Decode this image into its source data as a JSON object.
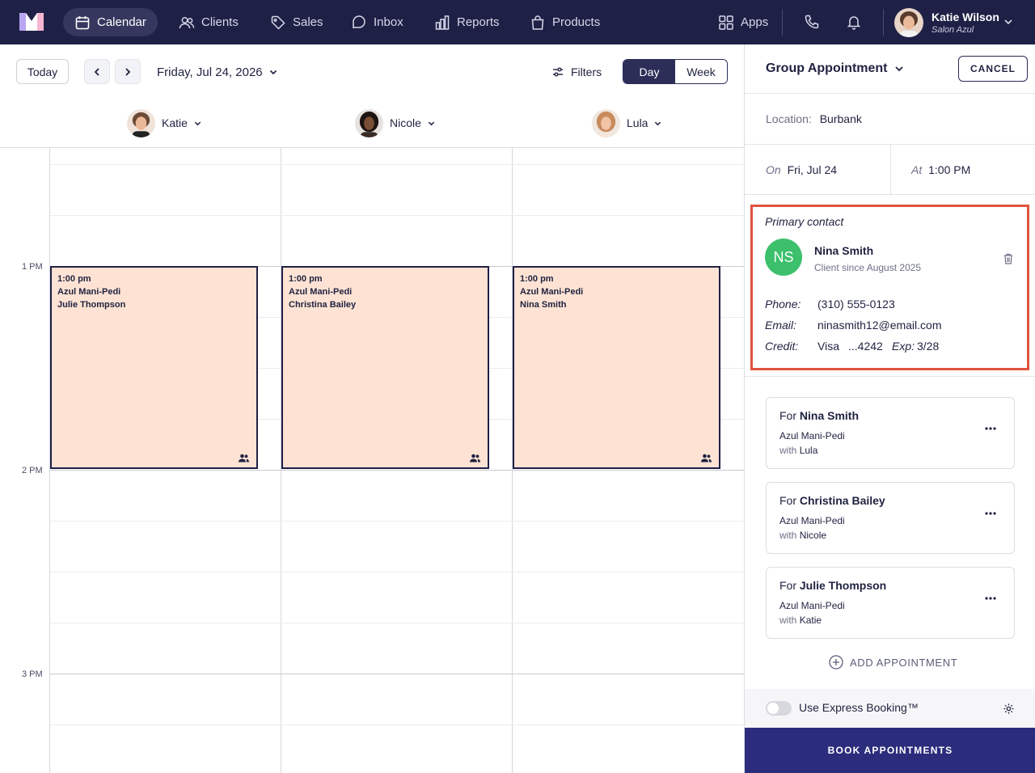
{
  "nav": {
    "items": [
      {
        "label": "Calendar",
        "icon": "calendar-icon",
        "active": true
      },
      {
        "label": "Clients",
        "icon": "users-icon"
      },
      {
        "label": "Sales",
        "icon": "tag-icon"
      },
      {
        "label": "Inbox",
        "icon": "chat-icon"
      },
      {
        "label": "Reports",
        "icon": "bar-chart-icon"
      },
      {
        "label": "Products",
        "icon": "bag-icon"
      }
    ],
    "apps_label": "Apps",
    "user": {
      "name": "Katie Wilson",
      "salon": "Salon Azul"
    }
  },
  "toolbar": {
    "today_label": "Today",
    "date_label": "Friday, Jul 24, 2026",
    "filters_label": "Filters",
    "view_day": "Day",
    "view_week": "Week",
    "active_view": "Day"
  },
  "staff": [
    {
      "name": "Katie"
    },
    {
      "name": "Nicole"
    },
    {
      "name": "Lula"
    }
  ],
  "time_labels": [
    "1 PM",
    "2 PM",
    "3 PM"
  ],
  "appointments": [
    {
      "time": "1:00 pm",
      "service": "Azul Mani-Pedi",
      "client": "Julie Thompson"
    },
    {
      "time": "1:00 pm",
      "service": "Azul Mani-Pedi",
      "client": "Christina Bailey"
    },
    {
      "time": "1:00 pm",
      "service": "Azul Mani-Pedi",
      "client": "Nina Smith"
    }
  ],
  "panel": {
    "title": "Group Appointment",
    "cancel_label": "CANCEL",
    "location_label": "Location:",
    "location_value": "Burbank",
    "on_label": "On",
    "on_value": "Fri, Jul 24",
    "at_label": "At",
    "at_value": "1:00 PM",
    "primary_contact": {
      "heading": "Primary contact",
      "initials": "NS",
      "name": "Nina Smith",
      "since": "Client since August 2025",
      "phone_label": "Phone:",
      "phone": "(310) 555-0123",
      "email_label": "Email:",
      "email": "ninasmith12@email.com",
      "credit_label": "Credit:",
      "card_brand": "Visa",
      "card_last4": "...4242",
      "exp_label": "Exp:",
      "exp_value": "3/28"
    },
    "group_items": [
      {
        "for_prefix": "For",
        "client": "Nina Smith",
        "service": "Azul Mani-Pedi",
        "with_prefix": "with",
        "staff": "Lula"
      },
      {
        "for_prefix": "For",
        "client": "Christina Bailey",
        "service": "Azul Mani-Pedi",
        "with_prefix": "with",
        "staff": "Nicole"
      },
      {
        "for_prefix": "For",
        "client": "Julie Thompson",
        "service": "Azul Mani-Pedi",
        "with_prefix": "with",
        "staff": "Katie"
      }
    ],
    "add_appointment_label": "ADD APPOINTMENT",
    "express_label": "Use Express Booking™",
    "express_enabled": false,
    "book_label": "BOOK APPOINTMENTS"
  },
  "colors": {
    "nav_bg": "#1f2046",
    "appointment_bg": "#fee3d4",
    "book_button": "#2b2c7c",
    "highlight_border": "#e0533f",
    "avatar_green": "#3cc06c"
  }
}
